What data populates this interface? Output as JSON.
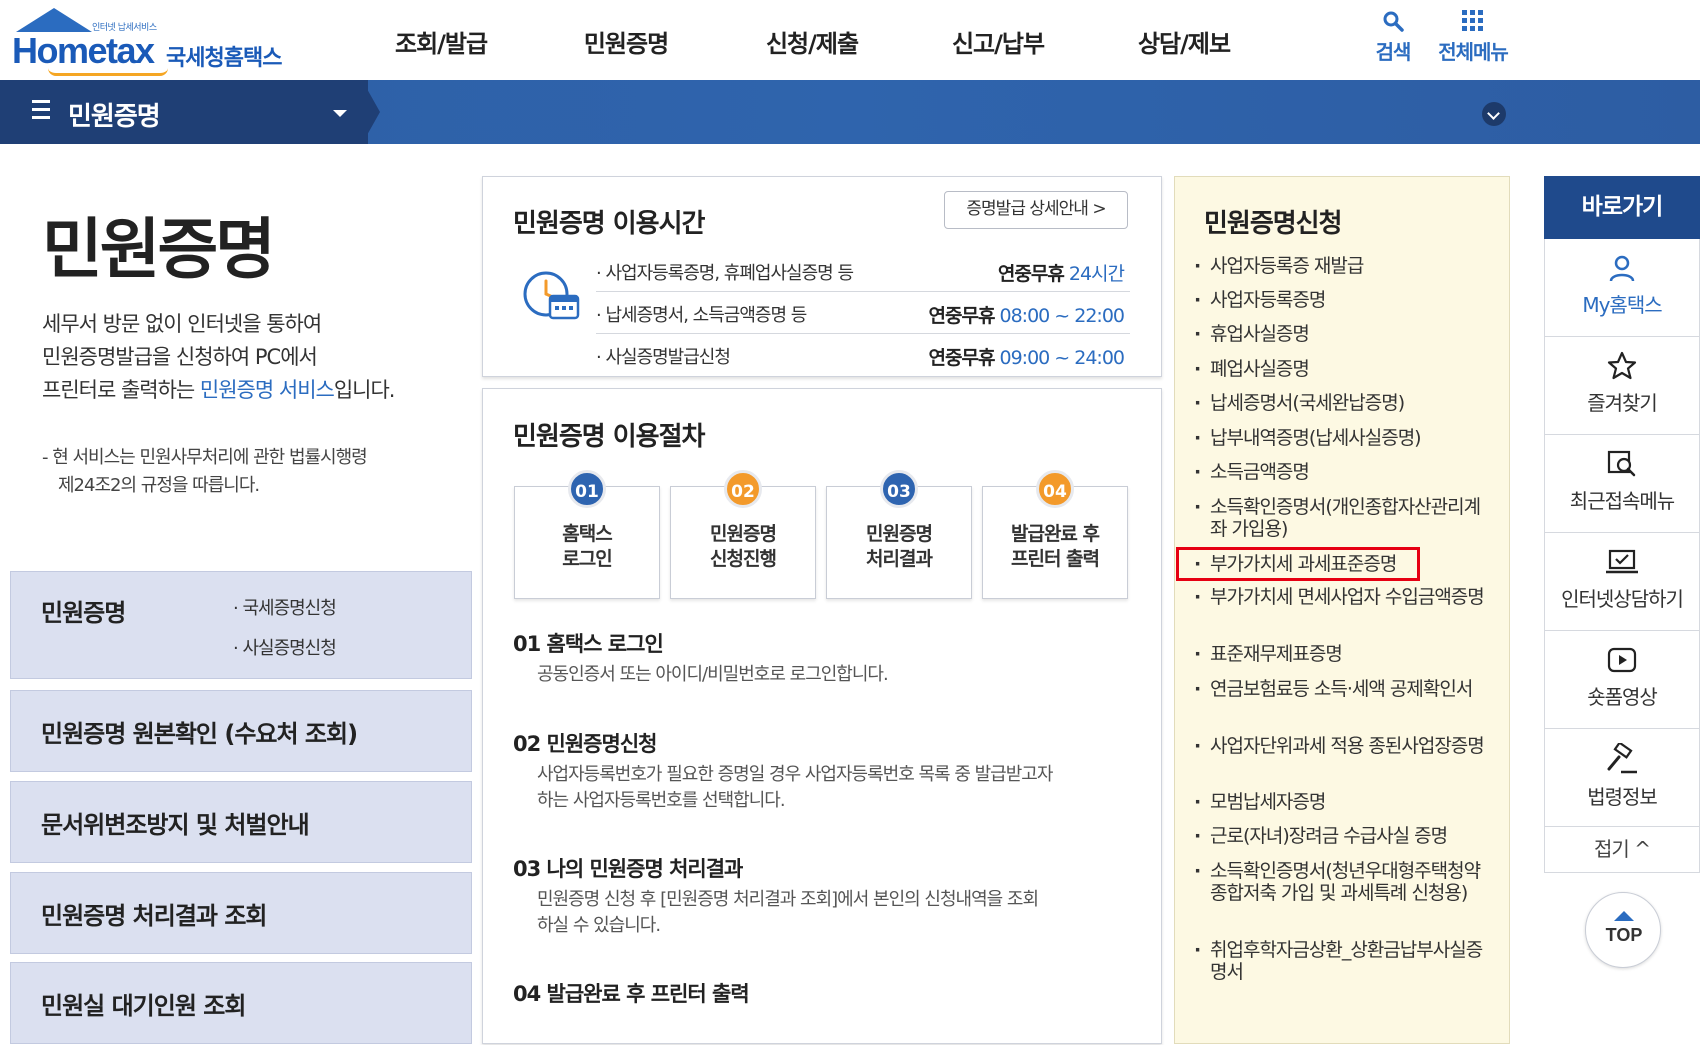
{
  "header": {
    "logo_tagline": "인터넷 납세서비스",
    "logo_word": "Hometax",
    "logo_kr": "국세청홈택스",
    "nav": [
      "조회/발급",
      "민원증명",
      "신청/제출",
      "신고/납부",
      "상담/제보"
    ],
    "search_label": "검색",
    "menu_label": "전체메뉴"
  },
  "subbar": {
    "title": "민원증명"
  },
  "intro": {
    "title": "민원증명",
    "desc_1": "세무서 방문 없이 인터넷을 통하여",
    "desc_2": "민원증명발급을 신청하여 PC에서",
    "desc_3_pre": "프린터로 출력하는 ",
    "desc_3_hl": "민원증명 서비스",
    "desc_3_post": "입니다.",
    "note_1": "- 현 서비스는 민원사무처리에 관한 법률시행령",
    "note_2": "제24조2의 규정을 따릅니다."
  },
  "left_menu": {
    "box1_title": "민원증명",
    "box1_sub1": "· 국세증명신청",
    "box1_sub2": "· 사실증명신청",
    "box2_title": "민원증명 원본확인 (수요처 조회)",
    "box3_title": "문서위변조방지 및 처벌안내",
    "box4_title": "민원증명 처리결과 조회",
    "box5_title": "민원실 대기인원 조회"
  },
  "usage_time": {
    "title": "민원증명 이용시간",
    "detail_button": "증명발급 상세안내 >",
    "rows": [
      {
        "label": "· 사업자등록증명, 휴폐업사실증명 등",
        "prefix": "연중무휴",
        "time": "24시간"
      },
      {
        "label": "· 납세증명서, 소득금액증명 등",
        "prefix": "연중무휴",
        "time": "08:00 ~ 22:00"
      },
      {
        "label": "· 사실증명발급신청",
        "prefix": "연중무휴",
        "time": "09:00 ~ 24:00"
      }
    ]
  },
  "procedure": {
    "title": "민원증명 이용절차",
    "steps": [
      {
        "num": "01",
        "line1": "홈택스",
        "line2": "로그인"
      },
      {
        "num": "02",
        "line1": "민원증명",
        "line2": "신청진행"
      },
      {
        "num": "03",
        "line1": "민원증명",
        "line2": "처리결과"
      },
      {
        "num": "04",
        "line1": "발급완료 후",
        "line2": "프린터 출력"
      }
    ],
    "detail": [
      {
        "head": "01 홈택스 로그인",
        "desc": "공동인증서 또는 아이디/비밀번호로 로그인합니다.",
        "desc2": ""
      },
      {
        "head": "02 민원증명신청",
        "desc": "사업자등록번호가 필요한 증명일 경우 사업자등록번호 목록 중 발급받고자",
        "desc2": "하는 사업자등록번호를 선택합니다."
      },
      {
        "head": "03 나의 민원증명 처리결과",
        "desc": "민원증명 신청 후 [민원증명 처리결과 조회]에서 본인의 신청내역을 조회",
        "desc2": "하실 수 있습니다."
      },
      {
        "head": "04 발급완료 후 프린터 출력",
        "desc": "",
        "desc2": ""
      }
    ]
  },
  "certificates": {
    "title": "민원증명신청",
    "items": [
      "사업자등록증 재발급",
      "사업자등록증명",
      "휴업사실증명",
      "폐업사실증명",
      "납세증명서(국세완납증명)",
      "납부내역증명(납세사실증명)",
      "소득금액증명",
      "소득확인증명서(개인종합자산관리계좌 가입용)",
      "부가가치세 과세표준증명",
      "부가가치세 면세사업자 수입금액증명",
      "표준재무제표증명",
      "연금보험료등 소득·세액 공제확인서",
      "사업자단위과세 적용 종된사업장증명",
      "모범납세자증명",
      "근로(자녀)장려금 수급사실 증명",
      "소득확인증명서(청년우대형주택청약종합저축 가입 및 과세특례 신청용)",
      "취업후학자금상환_상환금납부사실증명서"
    ]
  },
  "quick_menu": {
    "title": "바로가기",
    "items": [
      "My홈택스",
      "즐겨찾기",
      "최근접속메뉴",
      "인터넷상담하기",
      "숏폼영상",
      "법령정보"
    ],
    "fold": "접기 ^",
    "top": "TOP"
  },
  "colors": {
    "brand_blue": "#2b6cc0",
    "navy": "#1f3f75",
    "orange": "#f39a2b",
    "highlight_red": "#e60012",
    "panel_yellow": "#fdf9e3"
  }
}
